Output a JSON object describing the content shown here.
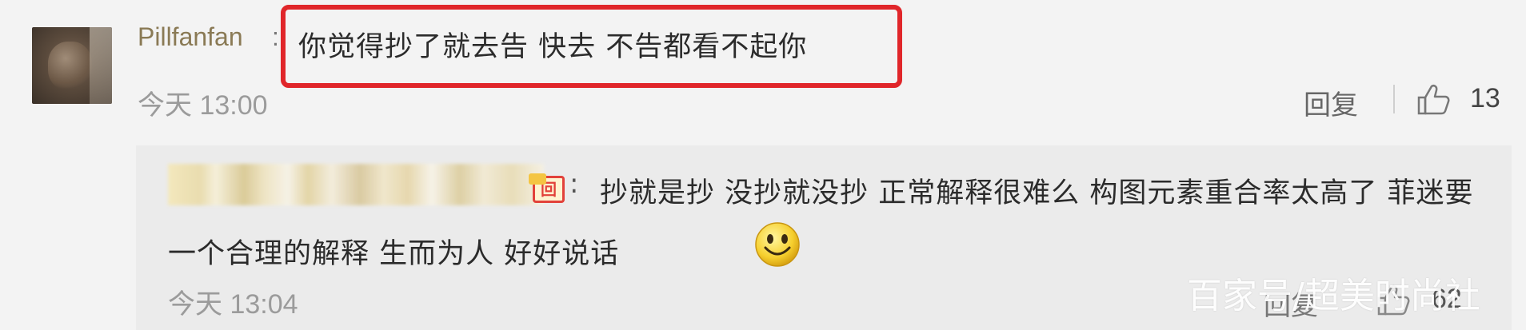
{
  "comment": {
    "username": "Pillfanfan",
    "colon": ":",
    "text": "你觉得抄了就去告 快去 不告都看不起你",
    "time": "今天 13:00",
    "reply_label": "回复",
    "like_count": "13"
  },
  "reply": {
    "colon": ":",
    "text": "抄就是抄 没抄就没抄 正常解释很难么 构图元素重合率太高了 菲迷要一个合理的解释 生而为人 好好说话",
    "time": "今天 13:04",
    "reply_label": "回复",
    "like_count": "62",
    "badge": "回"
  },
  "watermark": "百家号/超美时尚社",
  "colors": {
    "highlight": "#e0262a",
    "username": "#8a7a55",
    "background": "#f3f3f3"
  },
  "icons": [
    "avatar",
    "thumbs-up-icon",
    "smile-emoji-icon",
    "vip-badge-icon"
  ]
}
